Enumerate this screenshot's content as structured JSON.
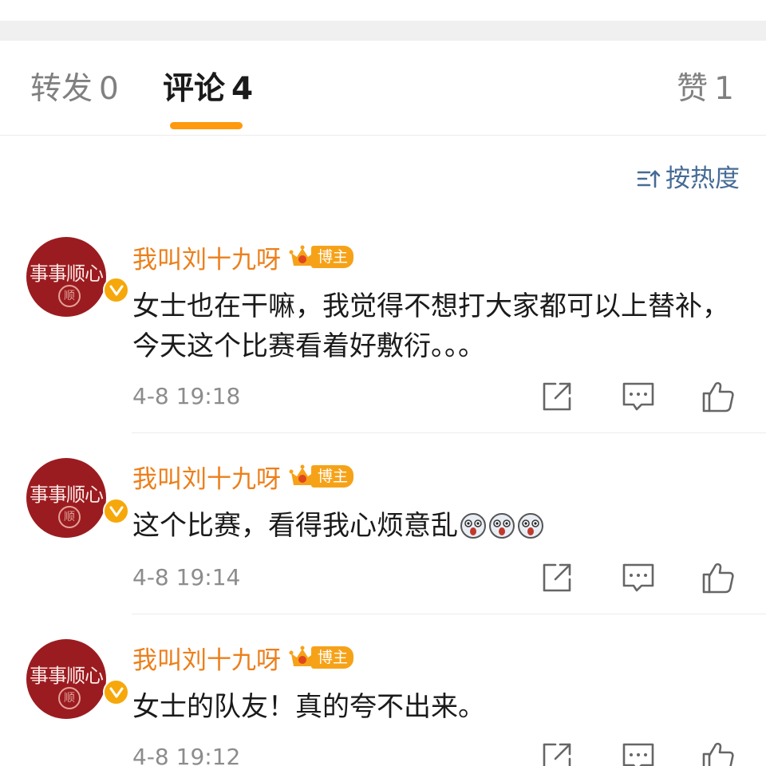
{
  "tabs": {
    "repost": {
      "label": "转发",
      "count": "0"
    },
    "comment": {
      "label": "评论",
      "count": "4"
    },
    "like": {
      "label": "赞",
      "count": "1"
    }
  },
  "sort": {
    "label": "按热度"
  },
  "avatar_text": {
    "main": "事事顺心",
    "seal": "顺"
  },
  "colors": {
    "accent": "#ff9a0e",
    "username": "#ec7f1b",
    "link": "#466b96",
    "avatar_bg": "#9b1c20"
  },
  "comments": [
    {
      "username": "我叫刘十九呀",
      "badge": "博主",
      "text": "女士也在干嘛，我觉得不想打大家都可以上替补，今天这个比赛看着好敷衍。。。",
      "time": "4-8 19:18"
    },
    {
      "username": "我叫刘十九呀",
      "badge": "博主",
      "text": "这个比赛，看得我心烦意乱",
      "emojis": [
        "shocked-face-emoji",
        "shocked-face-emoji",
        "shocked-face-emoji"
      ],
      "time": "4-8 19:14"
    },
    {
      "username": "我叫刘十九呀",
      "badge": "博主",
      "text": "女士的队友！真的夸不出来。",
      "time": "4-8 19:12"
    }
  ],
  "icons": {
    "share": "share-icon",
    "reply": "comment-icon",
    "like": "thumbs-up-icon",
    "verify": "verified-check-icon",
    "crown": "crown-icon",
    "sort": "sort-icon"
  }
}
